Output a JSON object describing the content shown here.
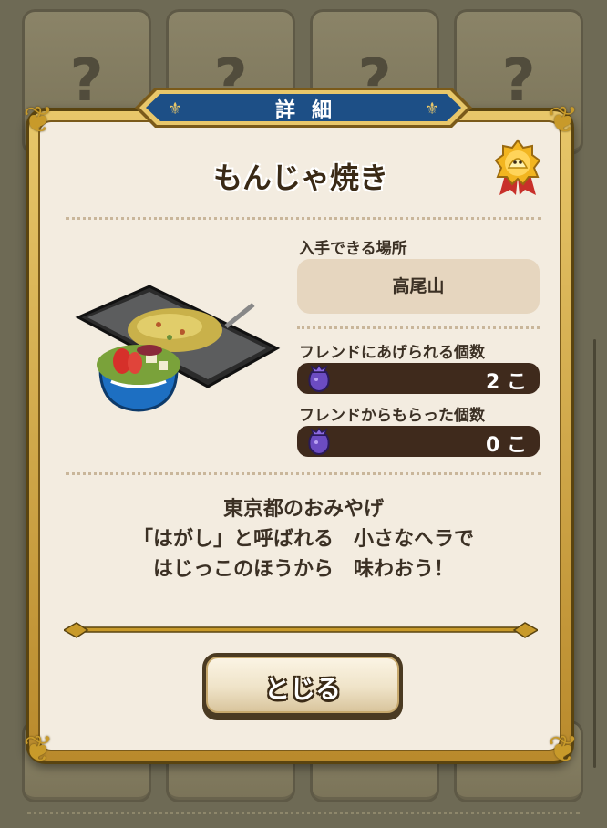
{
  "background": {
    "locked_cell_symbol": "?"
  },
  "dialog": {
    "banner_title": "詳細",
    "item_name": "もんじゃ焼き",
    "medal_icon": "gold-slime-medal-icon",
    "item_image": "monjayaki-icon",
    "location_label": "入手できる場所",
    "location_value": "高尾山",
    "giftable_label": "フレンドにあげられる個数",
    "giftable_count": "2 こ",
    "received_label": "フレンドからもらった個数",
    "received_count": "0 こ",
    "bag_icon": "purple-gift-bag-icon",
    "description": [
      "東京都のおみやげ",
      "「はがし」と呼ばれる　小さなヘラで",
      "はじっこのほうから　味わおう！"
    ],
    "close_button": "とじる"
  },
  "colors": {
    "banner_blue": "#1d4f86",
    "panel_gold": "#c89a2a",
    "panel_bg": "#f3ece0",
    "count_bar": "#3f2a1c"
  }
}
